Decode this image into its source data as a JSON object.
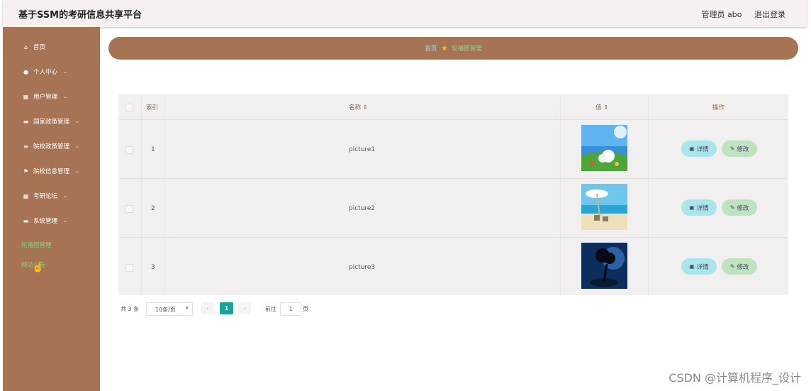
{
  "header": {
    "title": "基于SSM的考研信息共享平台",
    "user": "管理员 abo",
    "logout": "退出登录"
  },
  "sidebar": {
    "items": [
      {
        "icon": "home-icon",
        "glyph": "⌂",
        "label": "首页",
        "chev": ""
      },
      {
        "icon": "person-icon",
        "glyph": "●",
        "label": "个人中心",
        "chev": "⌄"
      },
      {
        "icon": "grid-icon",
        "glyph": "▦",
        "label": "用户管理",
        "chev": "⌄"
      },
      {
        "icon": "card-icon",
        "glyph": "▬",
        "label": "国家政策管理",
        "chev": "⌄"
      },
      {
        "icon": "list-icon",
        "glyph": "≡",
        "label": "院校政策管理",
        "chev": "⌄"
      },
      {
        "icon": "flag-icon",
        "glyph": "⚑",
        "label": "院校信息管理",
        "chev": "⌄"
      },
      {
        "icon": "grid-icon",
        "glyph": "▦",
        "label": "考研论坛",
        "chev": "⌄"
      },
      {
        "icon": "card-icon",
        "glyph": "▬",
        "label": "系统管理",
        "chev": "⌄"
      }
    ],
    "sub_items": [
      "轮播图管理",
      "网站公告"
    ]
  },
  "breadcrumb": {
    "home": "首页",
    "current": "轮播图管理"
  },
  "table": {
    "columns": {
      "index": "索引",
      "name": "名称 ⇕",
      "value": "值 ⇕",
      "action": "操作"
    },
    "rows": [
      {
        "index": "1",
        "name": "picture1"
      },
      {
        "index": "2",
        "name": "picture2"
      },
      {
        "index": "3",
        "name": "picture3"
      }
    ],
    "detail_label": "详情",
    "edit_label": "修改"
  },
  "pagination": {
    "total": "共 3 条",
    "page_size": "10条/页",
    "current": "1",
    "goto_label": "前往",
    "goto_value": "1",
    "page_unit": "页",
    "prev": "‹",
    "next": "›"
  },
  "watermark": "CSDN @计算机程序_设计",
  "colors": {
    "sidebar": "#a67455",
    "accent": "#1aa39a",
    "detail_btn": "#a8e6ec",
    "edit_btn": "#bfe3bf"
  }
}
